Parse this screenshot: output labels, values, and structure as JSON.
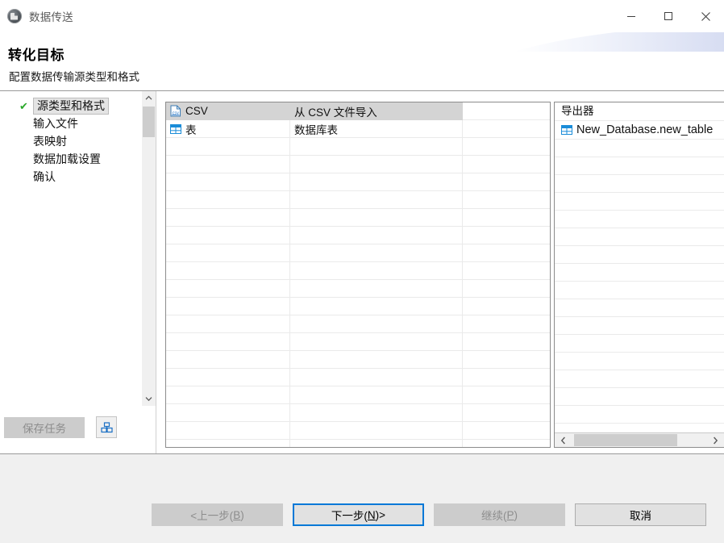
{
  "window": {
    "title": "数据传送",
    "icon": "app-icon",
    "controls": {
      "minimize": "最小化",
      "maximize": "最大化",
      "close": "关闭"
    }
  },
  "header": {
    "title": "转化目标",
    "subtitle": "配置数据传输源类型和格式"
  },
  "sidebar": {
    "items": [
      {
        "label": "源类型和格式",
        "selected": true,
        "checked": true
      },
      {
        "label": "输入文件",
        "selected": false,
        "checked": false
      },
      {
        "label": "表映射",
        "selected": false,
        "checked": false
      },
      {
        "label": "数据加载设置",
        "selected": false,
        "checked": false
      },
      {
        "label": "确认",
        "selected": false,
        "checked": false
      }
    ],
    "save_task_button": "保存任务",
    "save_task_icon": "package-icon"
  },
  "source_list": {
    "rows": [
      {
        "icon": "csv-file-icon",
        "name": "CSV",
        "description": "从 CSV 文件导入",
        "extra": "",
        "selected": true
      },
      {
        "icon": "table-icon",
        "name": "表",
        "description": "数据库表",
        "extra": "",
        "selected": false
      }
    ],
    "empty_row_count": 18
  },
  "exporter_panel": {
    "header": "导出器",
    "items": [
      {
        "icon": "table-icon",
        "label": "New_Database.new_table"
      }
    ],
    "empty_row_count": 16,
    "hscroll": {
      "left_arrow": "scroll-left-icon",
      "right_arrow": "scroll-right-icon"
    }
  },
  "footer": {
    "buttons": [
      {
        "name": "back",
        "label": "<上一步(B)",
        "state": "disabled",
        "accesskey": "B"
      },
      {
        "name": "next",
        "label": "下一步(N)>",
        "state": "default",
        "accesskey": "N"
      },
      {
        "name": "proceed",
        "label": "继续(P)",
        "state": "disabled",
        "accesskey": "P"
      },
      {
        "name": "cancel",
        "label": "取消",
        "state": "normal",
        "accesskey": ""
      }
    ]
  },
  "colors": {
    "accent": "#0078d7",
    "check_green": "#2aa82a",
    "icon_blue": "#1a8cd8",
    "selection_gray": "#d4d4d4",
    "footer_bg": "#f0f0f0"
  }
}
